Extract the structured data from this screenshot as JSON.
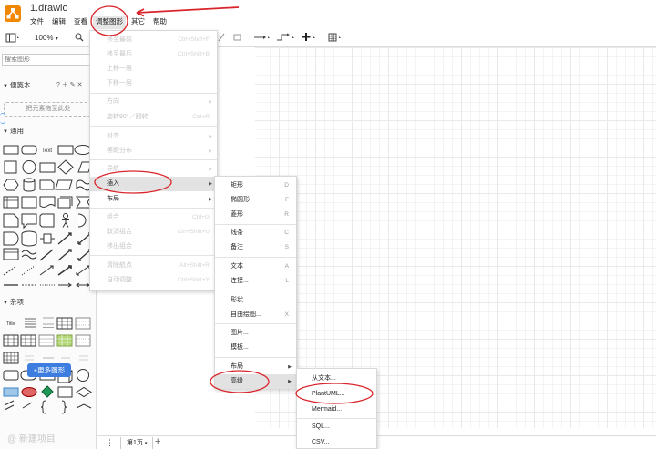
{
  "app": {
    "doc_title": "1.drawio",
    "brand_color": "#f08705"
  },
  "menubar": [
    {
      "label": "文件"
    },
    {
      "label": "编辑"
    },
    {
      "label": "查看"
    },
    {
      "label": "调整图形"
    },
    {
      "label": "其它"
    },
    {
      "label": "帮助"
    }
  ],
  "toolbar": {
    "zoom": "100%",
    "zoom_caret": "▾"
  },
  "sidebar": {
    "search_placeholder": "搜索图形",
    "scratchpad_title": "便笺本",
    "scratchpad_controls": "? ＋ ✎ ✕",
    "scratchpad_drop": "把元素拖至此处",
    "general_title": "通用",
    "misc_title": "杂项",
    "misc_text_shape": "Title",
    "more_shapes": "+更多图形"
  },
  "arrange_menu": {
    "items": [
      {
        "label": "移至最前",
        "shortcut": "Ctrl+Shift+F",
        "disabled": true
      },
      {
        "label": "移至最后",
        "shortcut": "Ctrl+Shift+B",
        "disabled": true
      },
      {
        "label": "上移一层",
        "shortcut": "",
        "disabled": true
      },
      {
        "label": "下移一层",
        "shortcut": "",
        "disabled": true
      },
      {
        "label": "方向",
        "shortcut": "",
        "disabled": true,
        "submenu": true
      },
      {
        "label": "旋转90°／翻转",
        "shortcut": "Ctrl+R",
        "disabled": true
      },
      {
        "label": "对齐",
        "shortcut": "",
        "disabled": true,
        "submenu": true
      },
      {
        "label": "等距分布",
        "shortcut": "",
        "disabled": true,
        "submenu": true
      },
      {
        "label": "导航",
        "shortcut": "",
        "disabled": true,
        "submenu": true
      },
      {
        "label": "插入",
        "shortcut": "",
        "disabled": false,
        "submenu": true,
        "active": true
      },
      {
        "label": "布局",
        "shortcut": "",
        "disabled": false,
        "submenu": true
      },
      {
        "label": "组合",
        "shortcut": "Ctrl+G",
        "disabled": true
      },
      {
        "label": "取消组合",
        "shortcut": "Ctrl+Shift+U",
        "disabled": true
      },
      {
        "label": "移出组合",
        "shortcut": "",
        "disabled": true
      },
      {
        "label": "清除航点",
        "shortcut": "Alt+Shift+R",
        "disabled": true
      },
      {
        "label": "自动调整",
        "shortcut": "Ctrl+Shift+Y",
        "disabled": true
      }
    ]
  },
  "insert_menu": {
    "items": [
      {
        "label": "矩形",
        "shortcut": "D"
      },
      {
        "label": "椭圆形",
        "shortcut": "F"
      },
      {
        "label": "菱形",
        "shortcut": "R"
      },
      {
        "label": "线条",
        "shortcut": "C"
      },
      {
        "label": "备注",
        "shortcut": "S"
      },
      {
        "label": "文本",
        "shortcut": "A"
      },
      {
        "label": "连接...",
        "shortcut": "L"
      },
      {
        "label": "形状...",
        "shortcut": ""
      },
      {
        "label": "自由绘图...",
        "shortcut": "X"
      },
      {
        "label": "图片...",
        "shortcut": ""
      },
      {
        "label": "模板...",
        "shortcut": ""
      },
      {
        "label": "布局",
        "shortcut": "",
        "submenu": true
      },
      {
        "label": "高级",
        "shortcut": "",
        "submenu": true,
        "active": true
      }
    ]
  },
  "advanced_menu": {
    "items": [
      {
        "label": "从文本..."
      },
      {
        "label": "PlantUML..."
      },
      {
        "label": "Mermaid..."
      },
      {
        "label": "SQL..."
      },
      {
        "label": "CSV..."
      }
    ]
  },
  "pagebar": {
    "page_tab": "第1页",
    "tab_caret": "▾",
    "dots": "⋮",
    "add": "+"
  },
  "watermark": "@ 新建项目"
}
